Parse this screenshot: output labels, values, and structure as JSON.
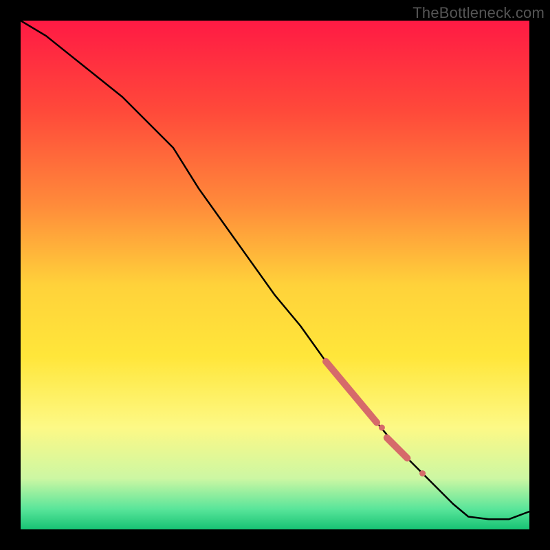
{
  "watermark": "TheBottleneck.com",
  "colors": {
    "bg_black": "#000000",
    "curve_stroke": "#000000",
    "marker_fill": "#d66a6a",
    "gradient_stops": [
      {
        "offset": 0.0,
        "color": "#ff1a44"
      },
      {
        "offset": 0.18,
        "color": "#ff4a3a"
      },
      {
        "offset": 0.36,
        "color": "#ff8a3a"
      },
      {
        "offset": 0.52,
        "color": "#ffd23a"
      },
      {
        "offset": 0.66,
        "color": "#ffe63a"
      },
      {
        "offset": 0.8,
        "color": "#fdf986"
      },
      {
        "offset": 0.9,
        "color": "#ccf7a3"
      },
      {
        "offset": 0.96,
        "color": "#59e59a"
      },
      {
        "offset": 1.0,
        "color": "#17c374"
      }
    ]
  },
  "chart_data": {
    "type": "line",
    "title": "",
    "xlabel": "",
    "ylabel": "",
    "xlim": [
      0,
      100
    ],
    "ylim": [
      0,
      100
    ],
    "legend": false,
    "grid": false,
    "x": [
      0,
      5,
      10,
      15,
      20,
      25,
      30,
      35,
      40,
      45,
      50,
      55,
      60,
      65,
      70,
      75,
      80,
      85,
      88,
      92,
      96,
      100
    ],
    "y": [
      100,
      97,
      93,
      89,
      85,
      80,
      75,
      67,
      60,
      53,
      46,
      40,
      33,
      27,
      21,
      15,
      10,
      5,
      2.5,
      2,
      2,
      3.5
    ],
    "markers": [
      {
        "kind": "segment",
        "x0": 60,
        "y0": 33,
        "x1": 70,
        "y1": 21,
        "width": 10
      },
      {
        "kind": "segment",
        "x0": 72,
        "y0": 18,
        "x1": 76,
        "y1": 14,
        "width": 10
      },
      {
        "kind": "dot",
        "x": 71,
        "y": 20,
        "r": 4.5
      },
      {
        "kind": "dot",
        "x": 79,
        "y": 11,
        "r": 4.5
      }
    ],
    "note": "x/y are normalized 0–100 within the plot rectangle. Gradient background encodes a red→yellow→green vertical scale (top=red ~ high bottleneck, bottom=green ~ low). The black curve decreases from top-left to bottom-right with a near-linear middle section and a small flat/upturn at the far right. Thick salmon segments and dots mark highlighted data ranges along the curve."
  }
}
